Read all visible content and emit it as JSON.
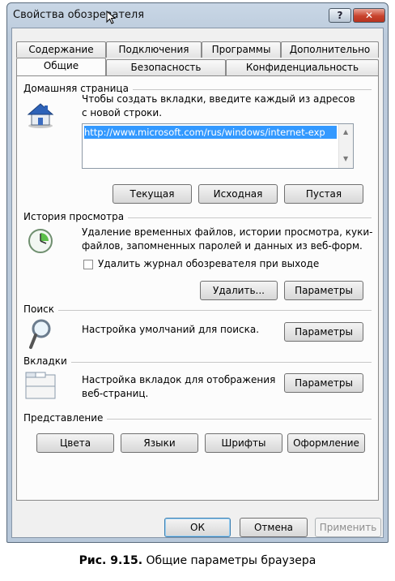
{
  "window": {
    "title": "Свойства обозревателя",
    "help_label": "?",
    "close_label": "✕"
  },
  "tabs_row1": [
    "Содержание",
    "Подключения",
    "Программы",
    "Дополнительно"
  ],
  "tabs_row2": [
    "Общие",
    "Безопасность",
    "Конфиденциальность"
  ],
  "home": {
    "group_title": "Домашняя страница",
    "instruction": "Чтобы создать вкладки, введите каждый из адресов с новой строки.",
    "url": "http://www.microsoft.com/rus/windows/internet-exp",
    "buttons": [
      "Текущая",
      "Исходная",
      "Пустая"
    ]
  },
  "history": {
    "group_title": "История просмотра",
    "text": "Удаление временных файлов, истории просмотра, куки-файлов, запомненных паролей и данных из веб-форм.",
    "checkbox_label": "Удалить журнал обозревателя при выходе",
    "delete_button": "Удалить...",
    "settings_button": "Параметры"
  },
  "search": {
    "group_title": "Поиск",
    "text": "Настройка умолчаний для поиска.",
    "settings_button": "Параметры"
  },
  "tabs_section": {
    "group_title": "Вкладки",
    "text": "Настройка вкладок для отображения веб-страниц.",
    "settings_button": "Параметры"
  },
  "appearance": {
    "group_title": "Представление",
    "buttons": [
      "Цвета",
      "Языки",
      "Шрифты",
      "Оформление"
    ]
  },
  "footer": {
    "ok": "ОК",
    "cancel": "Отмена",
    "apply": "Применить"
  },
  "caption": {
    "label": "Рис. 9.15.",
    "text": "Общие параметры браузера"
  },
  "colors": {
    "url_highlight": "#3399ff",
    "close_button": "#c8432d"
  }
}
